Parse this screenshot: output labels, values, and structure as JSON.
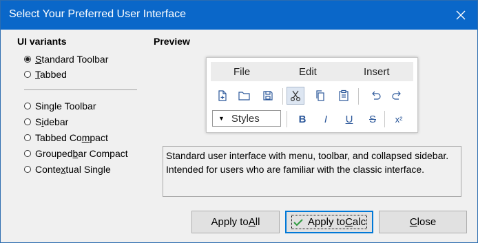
{
  "window": {
    "title": "Select Your Preferred User Interface"
  },
  "variants_label": "UI variants",
  "preview_label": "Preview",
  "variants": [
    {
      "pre": "",
      "mn": "S",
      "post": "tandard Toolbar",
      "selected": true
    },
    {
      "pre": "",
      "mn": "T",
      "post": "abbed",
      "selected": false
    },
    {
      "pre": "Sin",
      "mn": "g",
      "post": "le Toolbar",
      "selected": false
    },
    {
      "pre": "S",
      "mn": "i",
      "post": "debar",
      "selected": false
    },
    {
      "pre": "Tabbed Co",
      "mn": "m",
      "post": "pact",
      "selected": false
    },
    {
      "pre": "Grouped",
      "mn": "b",
      "post": "ar Compact",
      "selected": false
    },
    {
      "pre": "Conte",
      "mn": "x",
      "post": "tual Single",
      "selected": false
    }
  ],
  "preview": {
    "menus": [
      "File",
      "Edit",
      "Insert"
    ],
    "styles_label": "Styles",
    "styles_arrow": "▼",
    "format": {
      "bold": "B",
      "italic": "I",
      "underline": "U",
      "strike": "S",
      "superscript": "x²"
    }
  },
  "description": "Standard user interface with menu, toolbar, and collapsed sidebar. Intended for users who are familiar with the classic interface.",
  "buttons": {
    "apply_all": {
      "pre": "Apply to ",
      "mn": "A",
      "post": "ll"
    },
    "apply_calc": {
      "pre": "Apply to ",
      "mn": "C",
      "post": "alc"
    },
    "close": {
      "pre": "",
      "mn": "C",
      "post": "lose"
    }
  },
  "colors": {
    "titlebar": "#0a67c9",
    "accent": "#0078d7",
    "check": "#2e9a3e"
  }
}
